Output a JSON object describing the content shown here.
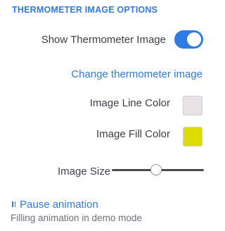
{
  "section": {
    "title": "THERMOMETER IMAGE OPTIONS"
  },
  "show_image": {
    "label": "Show Thermometer Image",
    "enabled": true
  },
  "change_image": {
    "label": "Change thermometer image"
  },
  "line_color": {
    "label": "Image Line Color",
    "value": "#e8e2e6"
  },
  "fill_color": {
    "label": "Image Fill Color",
    "value": "#dcdc00"
  },
  "image_size": {
    "label": "Image Size",
    "value_fraction": 0.48
  },
  "animation": {
    "pause_label": "Pause animation",
    "note": "Filling animation in demo mode"
  },
  "colors": {
    "accent": "#2f7ae5"
  },
  "icons": {
    "pause": "pause-icon"
  }
}
